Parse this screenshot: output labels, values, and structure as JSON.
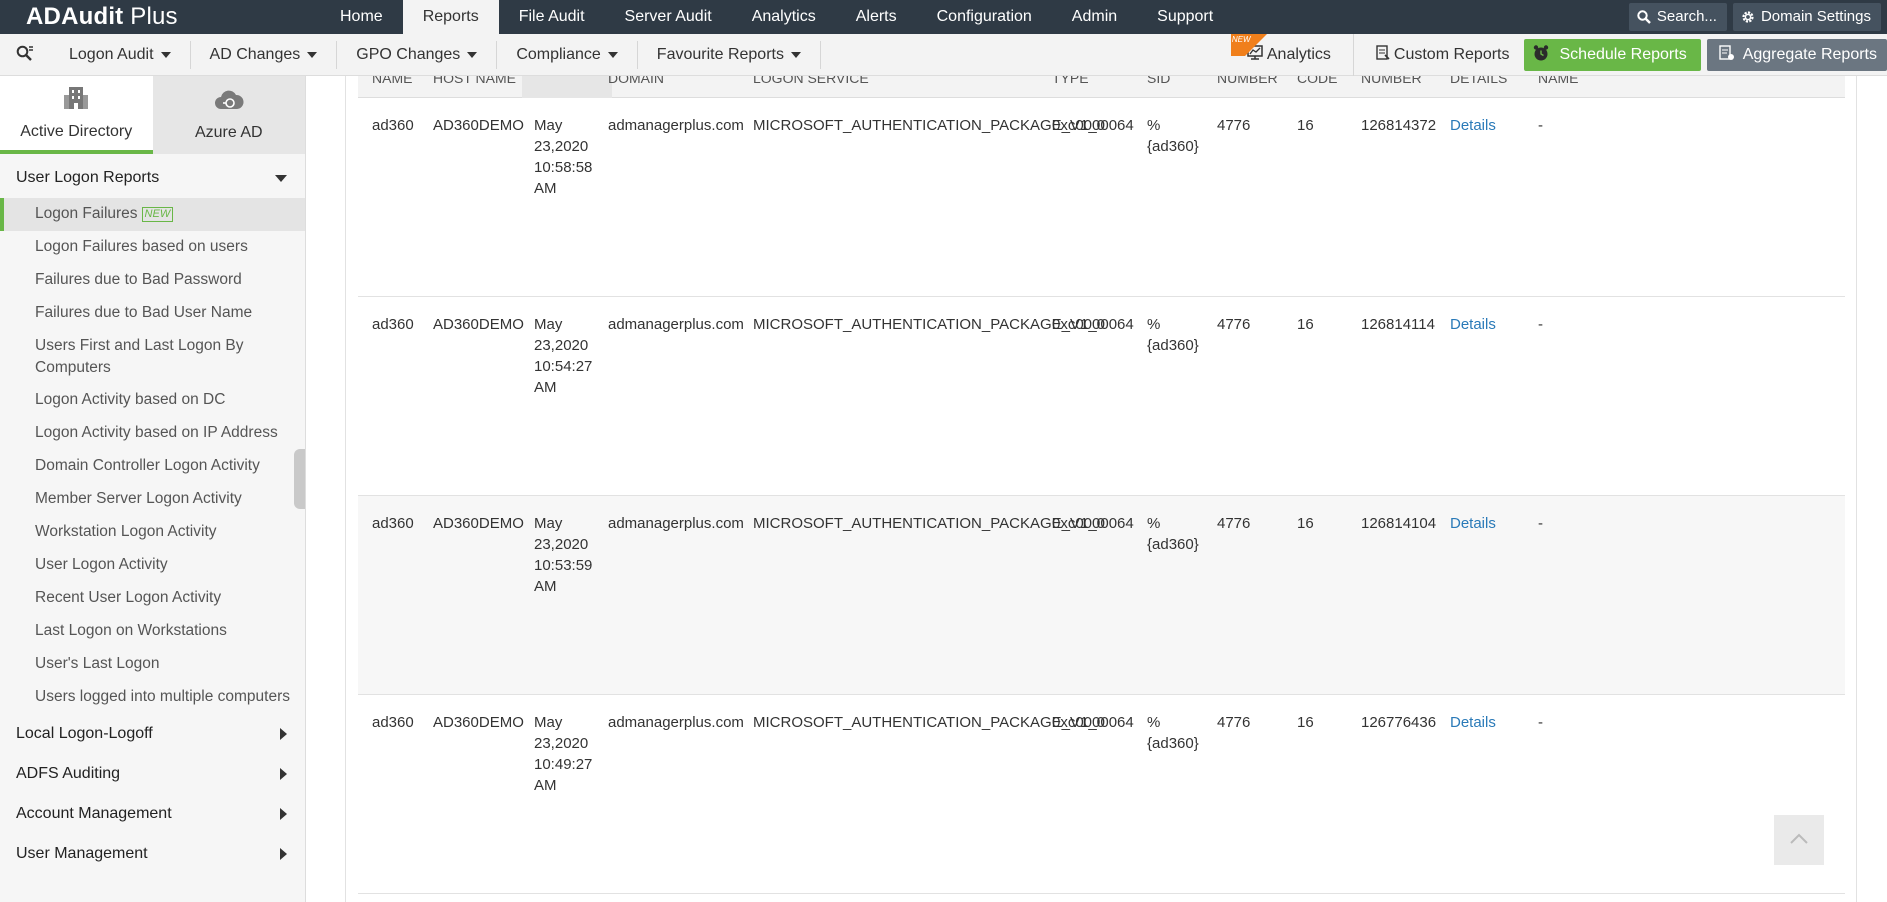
{
  "app": {
    "title_bold": "ADAudit",
    "title_rest": " Plus"
  },
  "top_nav": {
    "items": [
      "Home",
      "Reports",
      "File Audit",
      "Server Audit",
      "Analytics",
      "Alerts",
      "Configuration",
      "Admin",
      "Support"
    ],
    "active": "Reports",
    "search_label": "Search...",
    "domain_settings_label": "Domain Settings"
  },
  "sub_nav": {
    "menus": [
      "Logon Audit",
      "AD Changes",
      "GPO Changes",
      "Compliance",
      "Favourite Reports"
    ],
    "new_ribbon": "NEW",
    "analytics_label": "Analytics",
    "custom_reports_label": "Custom Reports",
    "schedule_reports_label": "Schedule Reports",
    "aggregate_reports_label": "Aggregate Reports"
  },
  "sidebar": {
    "tabs": [
      "Active Directory",
      "Azure AD"
    ],
    "active_tab": "Active Directory",
    "section_open": "User Logon Reports",
    "items": [
      "Logon Failures",
      "Logon Failures based on users",
      "Failures due to Bad Password",
      "Failures due to Bad User Name",
      "Users First and Last Logon By Computers",
      "Logon Activity based on DC",
      "Logon Activity based on IP Address",
      "Domain Controller Logon Activity",
      "Member Server Logon Activity",
      "Workstation Logon Activity",
      "User Logon Activity",
      "Recent User Logon Activity",
      "Last Logon on Workstations",
      "User's Last Logon",
      "Users logged into multiple computers"
    ],
    "new_badge": "NEW",
    "collapsed_sections": [
      "Local Logon-Logoff",
      "ADFS Auditing",
      "Account Management",
      "User Management"
    ]
  },
  "table": {
    "headers": [
      "NAME",
      "HOST NAME",
      "",
      "DOMAIN",
      "LOGON SERVICE",
      "TYPE",
      "SID",
      "NUMBER",
      "CODE",
      "NUMBER",
      "DETAILS",
      "NAME"
    ],
    "rows": [
      {
        "name": "ad360",
        "host": "AD360DEMO",
        "time": [
          "May",
          "23,2020",
          "10:58:58",
          "AM"
        ],
        "domain": "admanagerplus.com",
        "service": "MICROSOFT_AUTHENTICATION_PACKAGE_V1_0",
        "type": "0xc0000064",
        "sid": [
          "%",
          "{ad360}"
        ],
        "event": "4776",
        "code": "16",
        "record": "126814372",
        "details": "Details",
        "last": "-"
      },
      {
        "name": "ad360",
        "host": "AD360DEMO",
        "time": [
          "May",
          "23,2020",
          "10:54:27",
          "AM"
        ],
        "domain": "admanagerplus.com",
        "service": "MICROSOFT_AUTHENTICATION_PACKAGE_V1_0",
        "type": "0xc0000064",
        "sid": [
          "%",
          "{ad360}"
        ],
        "event": "4776",
        "code": "16",
        "record": "126814114",
        "details": "Details",
        "last": "-"
      },
      {
        "name": "ad360",
        "host": "AD360DEMO",
        "time": [
          "May",
          "23,2020",
          "10:53:59",
          "AM"
        ],
        "domain": "admanagerplus.com",
        "service": "MICROSOFT_AUTHENTICATION_PACKAGE_V1_0",
        "type": "0xc0000064",
        "sid": [
          "%",
          "{ad360}"
        ],
        "event": "4776",
        "code": "16",
        "record": "126814104",
        "details": "Details",
        "last": "-"
      },
      {
        "name": "ad360",
        "host": "AD360DEMO",
        "time": [
          "May",
          "23,2020",
          "10:49:27",
          "AM"
        ],
        "domain": "admanagerplus.com",
        "service": "MICROSOFT_AUTHENTICATION_PACKAGE_V1_0",
        "type": "0xc0000064",
        "sid": [
          "%",
          "{ad360}"
        ],
        "event": "4776",
        "code": "16",
        "record": "126776436",
        "details": "Details",
        "last": "-"
      }
    ]
  },
  "colors": {
    "topbar": "#2f3a45",
    "accent_green": "#69b747",
    "link_blue": "#2a7ab8",
    "aggregate_gray": "#6b7681"
  },
  "icons": [
    "search-icon",
    "gear-icon",
    "analytics-icon",
    "custom-report-icon",
    "alarm-clock-icon",
    "aggregate-icon",
    "building-icon",
    "cloud-icon",
    "chevron-up-icon"
  ]
}
